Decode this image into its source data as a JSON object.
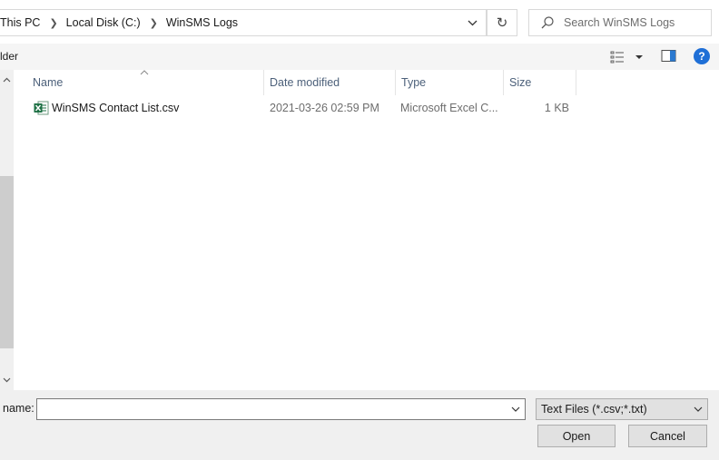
{
  "address_bar": {
    "crumbs": [
      "This PC",
      "Local Disk (C:)",
      "WinSMS Logs"
    ]
  },
  "search": {
    "placeholder": "Search WinSMS Logs"
  },
  "toolbar": {
    "partial_label": "lder",
    "help_label": "?"
  },
  "columns": [
    {
      "label": "Name"
    },
    {
      "label": "Date modified"
    },
    {
      "label": "Type"
    },
    {
      "label": "Size"
    }
  ],
  "files": [
    {
      "name": "WinSMS Contact List.csv",
      "date_modified": "2021-03-26 02:59 PM",
      "type": "Microsoft Excel C...",
      "size": "1 KB",
      "icon": "excel-csv-icon"
    }
  ],
  "bottom": {
    "name_label": "name:",
    "name_value": "",
    "file_type": "Text Files (*.csv;*.txt)",
    "open_label": "Open",
    "cancel_label": "Cancel"
  },
  "colors": {
    "accent": "#1f6fd6",
    "excel_green": "#1d7044",
    "header_text": "#4c607a"
  }
}
